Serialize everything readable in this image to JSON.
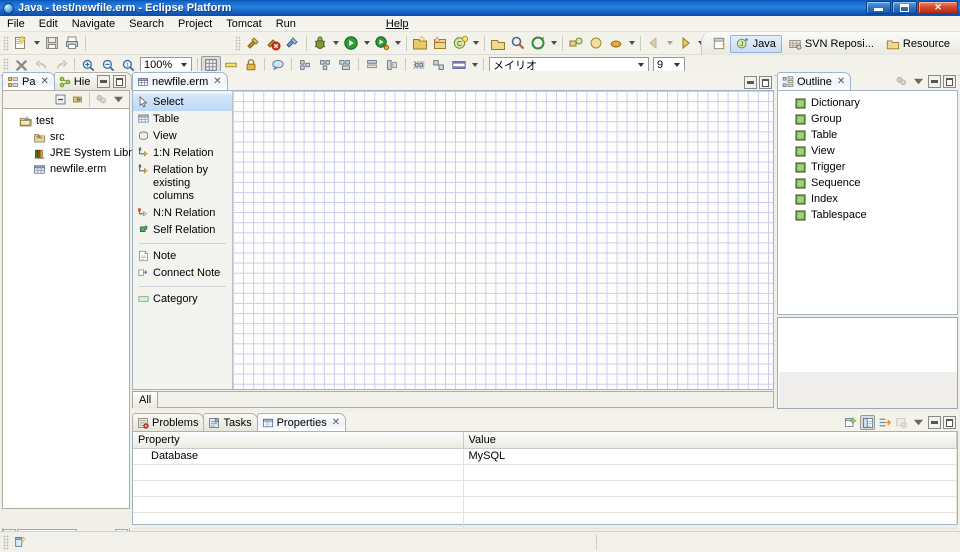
{
  "window": {
    "title": "Java - test/newfile.erm - Eclipse Platform",
    "icon": "eclipse-icon",
    "controls": {
      "minimize": "minimize",
      "restore": "restore",
      "close": "close"
    }
  },
  "menubar": {
    "items": [
      {
        "label": "File",
        "name": "menu-file"
      },
      {
        "label": "Edit",
        "name": "menu-edit"
      },
      {
        "label": "Navigate",
        "name": "menu-navigate"
      },
      {
        "label": "Search",
        "name": "menu-search"
      },
      {
        "label": "Project",
        "name": "menu-project"
      },
      {
        "label": "Tomcat",
        "name": "menu-tomcat"
      },
      {
        "label": "Run",
        "name": "menu-run"
      },
      {
        "label": "Help",
        "name": "menu-help"
      }
    ]
  },
  "toolbar_top": {
    "groups": [
      [
        "new-wizard-icon",
        "new-dropdown",
        "save-icon",
        "print-icon"
      ],
      [
        "build-all-icon",
        "build-error-icon",
        "build-project-icon"
      ],
      [
        "debug-icon",
        "debug-dropdown",
        "run-icon",
        "run-dropdown",
        "external-tools-icon",
        "external-tools-dropdown"
      ],
      [
        "new-java-project-icon",
        "new-package-icon",
        "new-class-icon",
        "new-class-dropdown"
      ],
      [
        "open-type-icon",
        "search-icon",
        "quick-access-icon",
        "quick-dropdown"
      ],
      [
        "next-annotation-icon",
        "next-dropdown",
        "previous-annotation-icon",
        "previous-dropdown",
        "back-icon",
        "back-dropdown",
        "forward-icon",
        "forward-dropdown"
      ]
    ]
  },
  "toolbar_second": {
    "delete_icon": "delete-icon",
    "undo_icon": "undo-icon",
    "redo_icon": "redo-icon",
    "zoom_in_icon": "zoom-in-icon",
    "zoom_out_icon": "zoom-out-icon",
    "zoom_actual_icon": "zoom-actual-icon",
    "zoom_value": "100%",
    "grid_icon": "grid-icon",
    "ruler_icon": "ruler-icon",
    "lock_icon": "lock-icon",
    "tooltip_icon": "tooltip-icon",
    "align_icons": [
      "align-left-icon",
      "align-center-icon",
      "align-right-icon",
      "align-top-icon",
      "align-middle-icon",
      "align-bottom-icon",
      "match-width-icon",
      "match-height-icon",
      "group-icon",
      "ungroup-icon"
    ],
    "fill_color_icon": "fill-color-icon",
    "font_name": "メイリオ",
    "font_size": "9"
  },
  "perspective": {
    "open_icon": "open-perspective-icon",
    "items": [
      {
        "label": "Java",
        "name": "perspective-java",
        "active": true,
        "icon": "java-perspective-icon"
      },
      {
        "label": "SVN Reposi...",
        "name": "perspective-svn",
        "active": false,
        "icon": "svn-perspective-icon"
      },
      {
        "label": "Resource",
        "name": "perspective-resource",
        "active": false,
        "icon": "resource-perspective-icon"
      }
    ]
  },
  "package_explorer": {
    "tabs": [
      {
        "label": "Pa",
        "name": "tab-package-explorer",
        "active": true,
        "icon": "package-explorer-icon",
        "closeable": true
      },
      {
        "label": "Hie",
        "name": "tab-hierarchy",
        "active": false,
        "icon": "hierarchy-icon",
        "closeable": false
      }
    ],
    "view_toolbar": [
      "collapse-all-icon",
      "link-with-editor-icon",
      "view-filter-icon",
      "view-menu-icon"
    ],
    "tree": [
      {
        "label": "test",
        "icon": "project-icon",
        "level": 1
      },
      {
        "label": "src",
        "icon": "source-folder-icon",
        "level": 2
      },
      {
        "label": "JRE System Libra",
        "icon": "library-icon",
        "level": 2
      },
      {
        "label": "newfile.erm",
        "icon": "erm-file-icon",
        "level": 2
      }
    ],
    "scrollbar": {
      "name": "horizontal-scrollbar"
    }
  },
  "editor": {
    "tab": {
      "label": "newfile.erm",
      "icon": "erm-file-icon",
      "close": "✕"
    },
    "minimize": "minimize-view",
    "maximize": "maximize-view",
    "palette": {
      "items": [
        {
          "label": "Select",
          "icon": "select-arrow-icon",
          "selected": true
        },
        {
          "label": "Table",
          "icon": "table-icon",
          "selected": false
        },
        {
          "label": "View",
          "icon": "view-icon",
          "selected": false
        },
        {
          "label": "1:N Relation",
          "icon": "one-to-n-relation-icon",
          "selected": false
        },
        {
          "label": "Relation by existing columns",
          "icon": "relation-existing-columns-icon",
          "selected": false
        },
        {
          "label": "N:N Relation",
          "icon": "n-to-n-relation-icon",
          "selected": false
        },
        {
          "label": "Self Relation",
          "icon": "self-relation-icon",
          "selected": false
        },
        {
          "label": "Note",
          "icon": "note-icon",
          "selected": false,
          "sep_before": true
        },
        {
          "label": "Connect Note",
          "icon": "connect-note-icon",
          "selected": false
        },
        {
          "label": "Category",
          "icon": "category-icon",
          "selected": false,
          "sep_before": true
        }
      ]
    },
    "bottom_tabs": [
      {
        "label": "All",
        "name": "editor-tab-all",
        "active": true
      }
    ]
  },
  "outline": {
    "tab": {
      "label": "Outline",
      "icon": "outline-icon",
      "close": "✕"
    },
    "view_toolbar": [
      "sort-icon",
      "view-menu-icon"
    ],
    "minimize": "minimize-view",
    "maximize": "maximize-view",
    "items": [
      {
        "label": "Dictionary",
        "icon": "node-icon"
      },
      {
        "label": "Group",
        "icon": "node-icon"
      },
      {
        "label": "Table",
        "icon": "node-icon"
      },
      {
        "label": "View",
        "icon": "node-icon"
      },
      {
        "label": "Trigger",
        "icon": "node-icon"
      },
      {
        "label": "Sequence",
        "icon": "node-icon"
      },
      {
        "label": "Index",
        "icon": "node-icon"
      },
      {
        "label": "Tablespace",
        "icon": "node-icon"
      }
    ]
  },
  "bottom_panel": {
    "tabs": [
      {
        "label": "Problems",
        "name": "tab-problems",
        "active": false,
        "icon": "problems-icon",
        "closeable": false
      },
      {
        "label": "Tasks",
        "name": "tab-tasks",
        "active": false,
        "icon": "tasks-icon",
        "closeable": false
      },
      {
        "label": "Properties",
        "name": "tab-properties",
        "active": true,
        "icon": "properties-icon",
        "closeable": true
      }
    ],
    "view_toolbar": [
      "new-tab-icon",
      "show-categories-icon",
      "show-advanced-icon",
      "restore-default-icon",
      "view-menu-icon"
    ],
    "minimize": "minimize-view",
    "maximize": "maximize-view",
    "table": {
      "columns": [
        "Property",
        "Value"
      ],
      "rows": [
        {
          "property": "Database",
          "value": "MySQL"
        },
        {
          "property": "",
          "value": ""
        },
        {
          "property": "",
          "value": ""
        },
        {
          "property": "",
          "value": ""
        },
        {
          "property": "",
          "value": ""
        }
      ]
    }
  },
  "statusbar": {
    "icon": "status-resource-icon",
    "text": ""
  },
  "colors": {
    "titlebar_blue": "#1265cc",
    "selection_blue": "#bcd9f5",
    "grid_line": "#c9cdf0",
    "toolbar_bg": "#f2f1ea",
    "panel_border": "#9fb4c8"
  }
}
